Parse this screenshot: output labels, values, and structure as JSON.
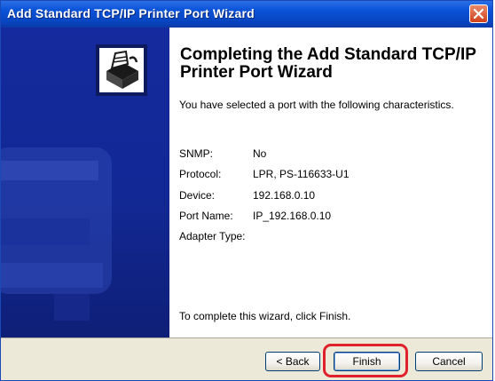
{
  "window": {
    "title": "Add Standard TCP/IP Printer Port Wizard",
    "close_icon": "close-icon"
  },
  "sidebar": {
    "icon": "printer-port-wizard-icon"
  },
  "content": {
    "heading": "Completing the Add Standard TCP/IP Printer Port Wizard",
    "intro": "You have selected a port with the following characteristics.",
    "properties": [
      {
        "label": "SNMP:",
        "value": "No"
      },
      {
        "label": "Protocol:",
        "value": "LPR,  PS-116633-U1"
      },
      {
        "label": "Device:",
        "value": "192.168.0.10"
      },
      {
        "label": "Port Name:",
        "value": "IP_192.168.0.10"
      },
      {
        "label": "Adapter Type:",
        "value": ""
      }
    ],
    "outro": "To complete this wizard, click Finish."
  },
  "buttons": {
    "back": "< Back",
    "finish": "Finish",
    "cancel": "Cancel"
  },
  "colors": {
    "titlebar": "#0a52d8",
    "sidebar": "#122894",
    "highlight": "#e0202a",
    "buttonbar": "#ece9d8"
  }
}
